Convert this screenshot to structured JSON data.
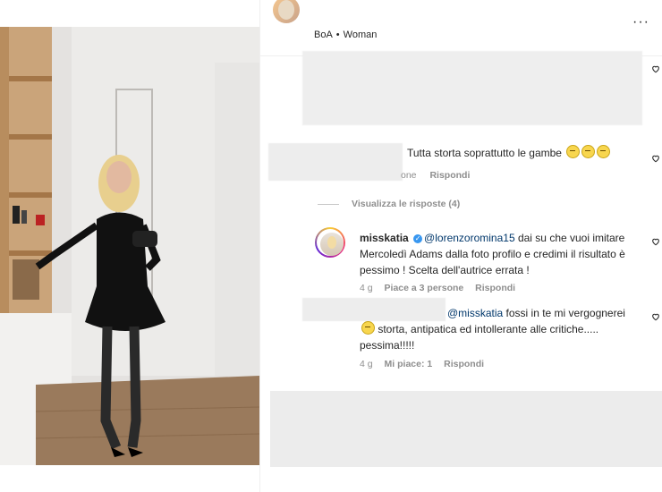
{
  "header": {
    "account_type": "BoA",
    "separator": "•",
    "category": "Woman",
    "more": "···"
  },
  "comment1": {
    "text": "Tutta storta soprattutto le gambe",
    "meta_partial": "one",
    "reply": "Rispondi"
  },
  "replies_toggle": "Visualizza le risposte (4)",
  "reply1": {
    "user": "misskatia",
    "mention": "@lorenzoromina15",
    "text": " dai su che vuoi imitare Mercoledì Adams dalla foto profilo e credimi il risultato è pessimo ! Scelta dell'autrice errata !",
    "time": "4 g",
    "likes": "Piace a 3 persone",
    "reply": "Rispondi"
  },
  "reply2": {
    "mention": "@misskatia",
    "text_a": " fossi in te mi vergognerei",
    "text_b": "storta, antipatica ed intollerante alle critiche..... pessima!!!!!",
    "time": "4 g",
    "likes": "Mi piace: 1",
    "reply": "Rispondi"
  },
  "icons": {
    "heart": "heart-outline-icon",
    "verified": "verified-badge-icon",
    "emoji": "grimacing-face-emoji"
  }
}
